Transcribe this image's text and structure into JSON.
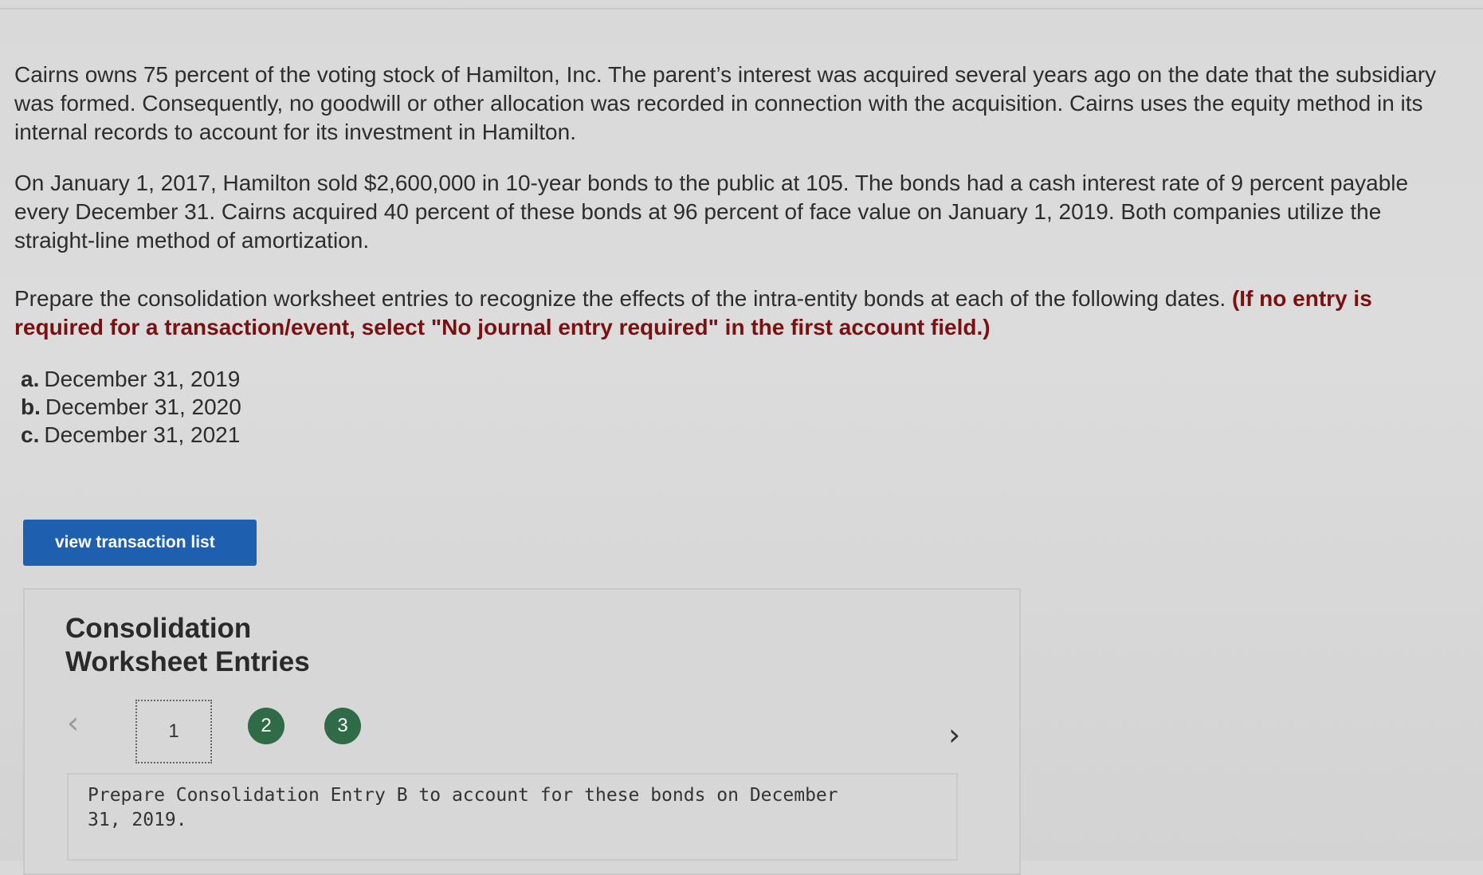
{
  "problem": {
    "paragraph1": "Cairns owns 75 percent of the voting stock of Hamilton, Inc. The parent’s interest was acquired several years ago on the date that the subsidiary was formed. Consequently, no goodwill or other allocation was recorded in connection with the acquisition. Cairns uses the equity method in its internal records to account for its investment in Hamilton.",
    "paragraph2": "On January 1, 2017, Hamilton sold $2,600,000 in 10-year bonds to the public at 105. The bonds had a cash interest rate of 9 percent payable every December 31. Cairns acquired 40 percent of these bonds at 96 percent of face value on January 1, 2019. Both companies utilize the straight-line method of amortization.",
    "paragraph3_text": "Prepare the consolidation worksheet entries to recognize the effects of the intra-entity bonds at each of the following dates. ",
    "paragraph3_instruction": "(If no entry is required for a transaction/event, select \"No journal entry required\" in the first account field.)",
    "dates": [
      {
        "letter": "a.",
        "text": "December 31, 2019"
      },
      {
        "letter": "b.",
        "text": "December 31, 2020"
      },
      {
        "letter": "c.",
        "text": "December 31, 2021"
      }
    ]
  },
  "view_button_label": "view transaction list",
  "worksheet": {
    "title": "Consolidation Worksheet Entries",
    "steps": [
      "1",
      "2",
      "3"
    ],
    "prev_glyph": "‹",
    "next_glyph": "›",
    "prompt": "Prepare Consolidation Entry B to account for these bonds on December 31, 2019."
  },
  "colors": {
    "button_bg": "#1f5fb0",
    "step_circle": "#2f6b47",
    "instruction_text": "#7a1010"
  }
}
